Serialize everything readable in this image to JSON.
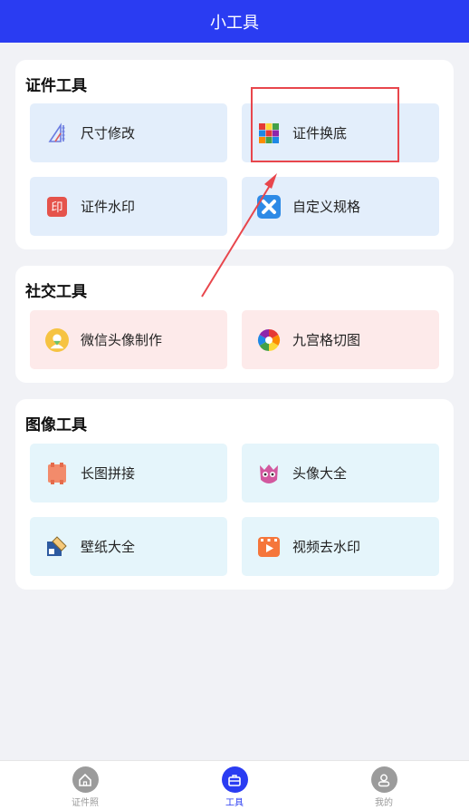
{
  "header": {
    "title": "小工具"
  },
  "sections": [
    {
      "title": "证件工具",
      "items": [
        {
          "label": "尺寸修改",
          "icon": "ruler-icon"
        },
        {
          "label": "证件换底",
          "icon": "color-grid-icon"
        },
        {
          "label": "证件水印",
          "icon": "seal-icon"
        },
        {
          "label": "自定义规格",
          "icon": "custom-size-icon"
        }
      ]
    },
    {
      "title": "社交工具",
      "items": [
        {
          "label": "微信头像制作",
          "icon": "avatar-maker-icon"
        },
        {
          "label": "九宫格切图",
          "icon": "camera-aperture-icon"
        }
      ]
    },
    {
      "title": "图像工具",
      "items": [
        {
          "label": "长图拼接",
          "icon": "photo-stitch-icon"
        },
        {
          "label": "头像大全",
          "icon": "avatar-collection-icon"
        },
        {
          "label": "壁纸大全",
          "icon": "wallpaper-icon"
        },
        {
          "label": "视频去水印",
          "icon": "video-icon"
        }
      ]
    }
  ],
  "tabbar": [
    {
      "label": "证件照",
      "icon": "home-icon",
      "active": false
    },
    {
      "label": "工具",
      "icon": "toolbox-icon",
      "active": true
    },
    {
      "label": "我的",
      "icon": "user-icon",
      "active": false
    }
  ],
  "colors": {
    "primary": "#2a3cf2",
    "annotation": "#e8464c"
  }
}
